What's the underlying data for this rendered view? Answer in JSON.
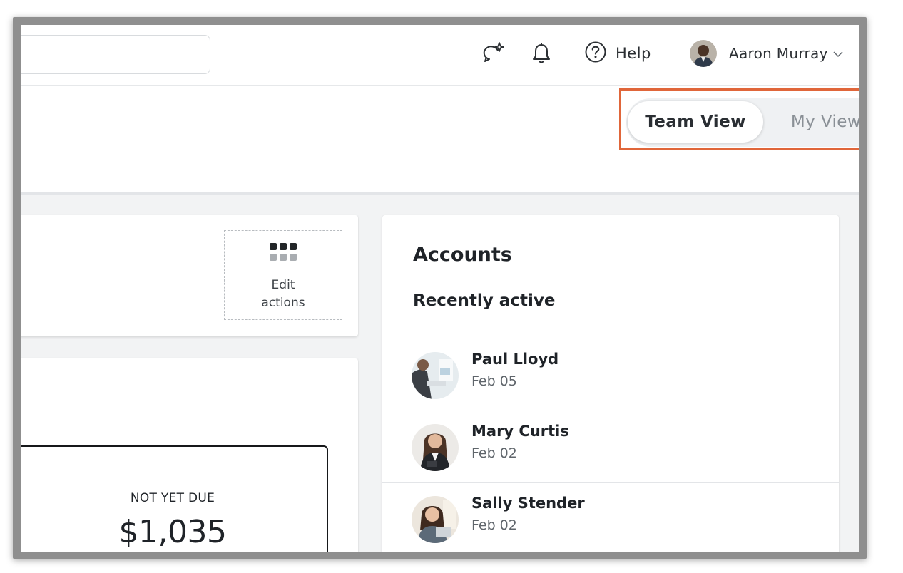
{
  "topbar": {
    "search": {
      "placeholder": "",
      "value": ""
    },
    "help_label": "Help",
    "user_name": "Aaron Murray"
  },
  "view_toggle": {
    "options": [
      "Team View",
      "My View"
    ],
    "selected": "Team View"
  },
  "actions_card": {
    "edit_label": "Edit actions"
  },
  "ar_card": {
    "label": "NOT YET DUE",
    "value": "$1,035"
  },
  "accounts_card": {
    "title": "Accounts",
    "subtitle": "Recently active",
    "items": [
      {
        "name": "Paul Lloyd",
        "date": "Feb 05"
      },
      {
        "name": "Mary Curtis",
        "date": "Feb 02"
      },
      {
        "name": "Sally Stender",
        "date": "Feb 02"
      }
    ]
  },
  "colors": {
    "highlight": "#e0663a",
    "toggle_bg": "#eff1f3",
    "page_bg": "#f2f3f4"
  }
}
